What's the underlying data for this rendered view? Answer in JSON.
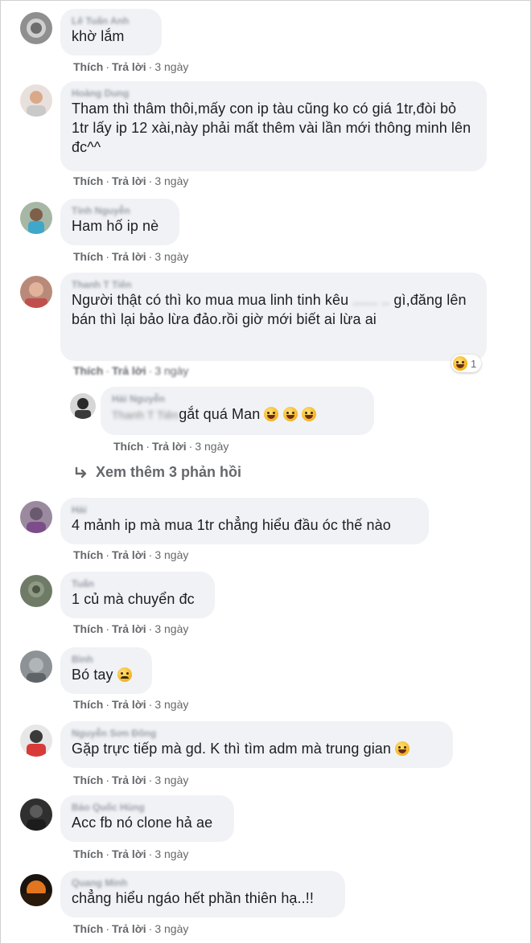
{
  "labels": {
    "like": "Thích",
    "reply": "Trả lời",
    "more_replies": "Xem thêm 3 phản hồi"
  },
  "comments": [
    {
      "author": "Lê Tuấn Anh",
      "text": "khờ lắm",
      "time": "3 ngày"
    },
    {
      "author": "Hoàng Dung",
      "text": "Tham thì thâm thôi,mấy con ip tàu cũng ko có giá 1tr,đòi bỏ 1tr lấy ip 12 xài,này phải mất thêm vài lần mới thông minh lên đc^^",
      "time": "3 ngày"
    },
    {
      "author": "Tính Nguyễn",
      "text": "Ham hố ip nè",
      "time": "3 ngày"
    },
    {
      "author": "Thanh T Tiên",
      "text_prefix": "Người thật có thì ko mua mua linh tinh kêu",
      "text_hidden": "...... ..",
      "text_suffix": "gì,đăng lên bán thì lại bảo lừa đảo.rồi giờ mới biết ai lừa ai",
      "time": "3 ngày",
      "reaction_count": "1"
    },
    {
      "author": "Hải Nguyễn",
      "hidden_mention": "Thanh T Tiên",
      "text": "gắt quá Man",
      "time": "3 ngày"
    },
    {
      "author": "Hải",
      "text": "4 mảnh ip mà mua 1tr chẳng hiểu đầu óc thế nào",
      "time": "3 ngày"
    },
    {
      "author": "Tuấn",
      "text": "1 củ mà chuyển đc",
      "time": "3 ngày"
    },
    {
      "author": "Bình",
      "text": "Bó tay",
      "time": "3 ngày"
    },
    {
      "author": "Nguyễn Sơn Đông",
      "text": "Gặp trực tiếp mà gd. K thì tìm adm mà trung gian",
      "time": "3 ngày"
    },
    {
      "author": "Bảo Quốc Hùng",
      "text": "Acc fb nó clone hả ae",
      "time": "3 ngày"
    },
    {
      "author": "Quang Minh",
      "text": "chẳng hiểu ngáo hết phần thiên hạ..!!",
      "time": "3 ngày"
    }
  ],
  "icons": {
    "reply_arrow": "reply-arrow-icon",
    "reaction": "haha-emoji-icon",
    "emoji_laugh": "rofl-emoji-icon",
    "emoji_sad": "sad-emoji-icon",
    "emoji_grin": "grin-emoji-icon"
  },
  "colors": {
    "bubble": "#f0f2f5",
    "meta": "#65676b",
    "text": "#1c1e21"
  }
}
